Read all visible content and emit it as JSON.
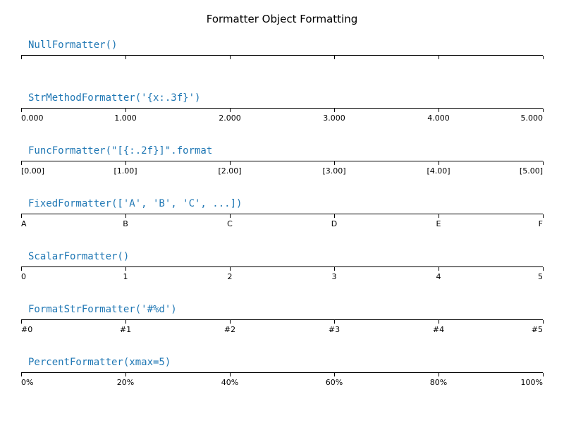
{
  "title": "Formatter Object Formatting",
  "chart_data": [
    {
      "type": "line",
      "title": "NullFormatter()",
      "x": [
        0,
        1,
        2,
        3,
        4,
        5
      ],
      "tick_labels": [
        "",
        "",
        "",
        "",
        "",
        ""
      ],
      "xlim": [
        0,
        5
      ],
      "ylim": [
        0,
        1
      ],
      "xlabel": "",
      "ylabel": ""
    },
    {
      "type": "line",
      "title": "StrMethodFormatter('{x:.3f}')",
      "x": [
        0,
        1,
        2,
        3,
        4,
        5
      ],
      "tick_labels": [
        "0.000",
        "1.000",
        "2.000",
        "3.000",
        "4.000",
        "5.000"
      ],
      "xlim": [
        0,
        5
      ],
      "ylim": [
        0,
        1
      ],
      "xlabel": "",
      "ylabel": ""
    },
    {
      "type": "line",
      "title": "FuncFormatter(\"[{:.2f}]\".format",
      "x": [
        0,
        1,
        2,
        3,
        4,
        5
      ],
      "tick_labels": [
        "[0.00]",
        "[1.00]",
        "[2.00]",
        "[3.00]",
        "[4.00]",
        "[5.00]"
      ],
      "xlim": [
        0,
        5
      ],
      "ylim": [
        0,
        1
      ],
      "xlabel": "",
      "ylabel": ""
    },
    {
      "type": "line",
      "title": "FixedFormatter(['A', 'B', 'C', ...])",
      "x": [
        0,
        1,
        2,
        3,
        4,
        5
      ],
      "tick_labels": [
        "A",
        "B",
        "C",
        "D",
        "E",
        "F"
      ],
      "xlim": [
        0,
        5
      ],
      "ylim": [
        0,
        1
      ],
      "xlabel": "",
      "ylabel": ""
    },
    {
      "type": "line",
      "title": "ScalarFormatter()",
      "x": [
        0,
        1,
        2,
        3,
        4,
        5
      ],
      "tick_labels": [
        "0",
        "1",
        "2",
        "3",
        "4",
        "5"
      ],
      "xlim": [
        0,
        5
      ],
      "ylim": [
        0,
        1
      ],
      "xlabel": "",
      "ylabel": ""
    },
    {
      "type": "line",
      "title": "FormatStrFormatter('#%d')",
      "x": [
        0,
        1,
        2,
        3,
        4,
        5
      ],
      "tick_labels": [
        "#0",
        "#1",
        "#2",
        "#3",
        "#4",
        "#5"
      ],
      "xlim": [
        0,
        5
      ],
      "ylim": [
        0,
        1
      ],
      "xlabel": "",
      "ylabel": ""
    },
    {
      "type": "line",
      "title": "PercentFormatter(xmax=5)",
      "x": [
        0,
        1,
        2,
        3,
        4,
        5
      ],
      "tick_labels": [
        "0%",
        "20%",
        "40%",
        "60%",
        "80%",
        "100%"
      ],
      "xlim": [
        0,
        5
      ],
      "ylim": [
        0,
        1
      ],
      "xlabel": "",
      "ylabel": ""
    }
  ],
  "layout": {
    "block_tops": [
      56,
      131,
      206,
      281,
      356,
      431,
      506
    ],
    "label_color": "#1f77b4",
    "tick_positions_pct": [
      0,
      20,
      40,
      60,
      80,
      100
    ]
  }
}
